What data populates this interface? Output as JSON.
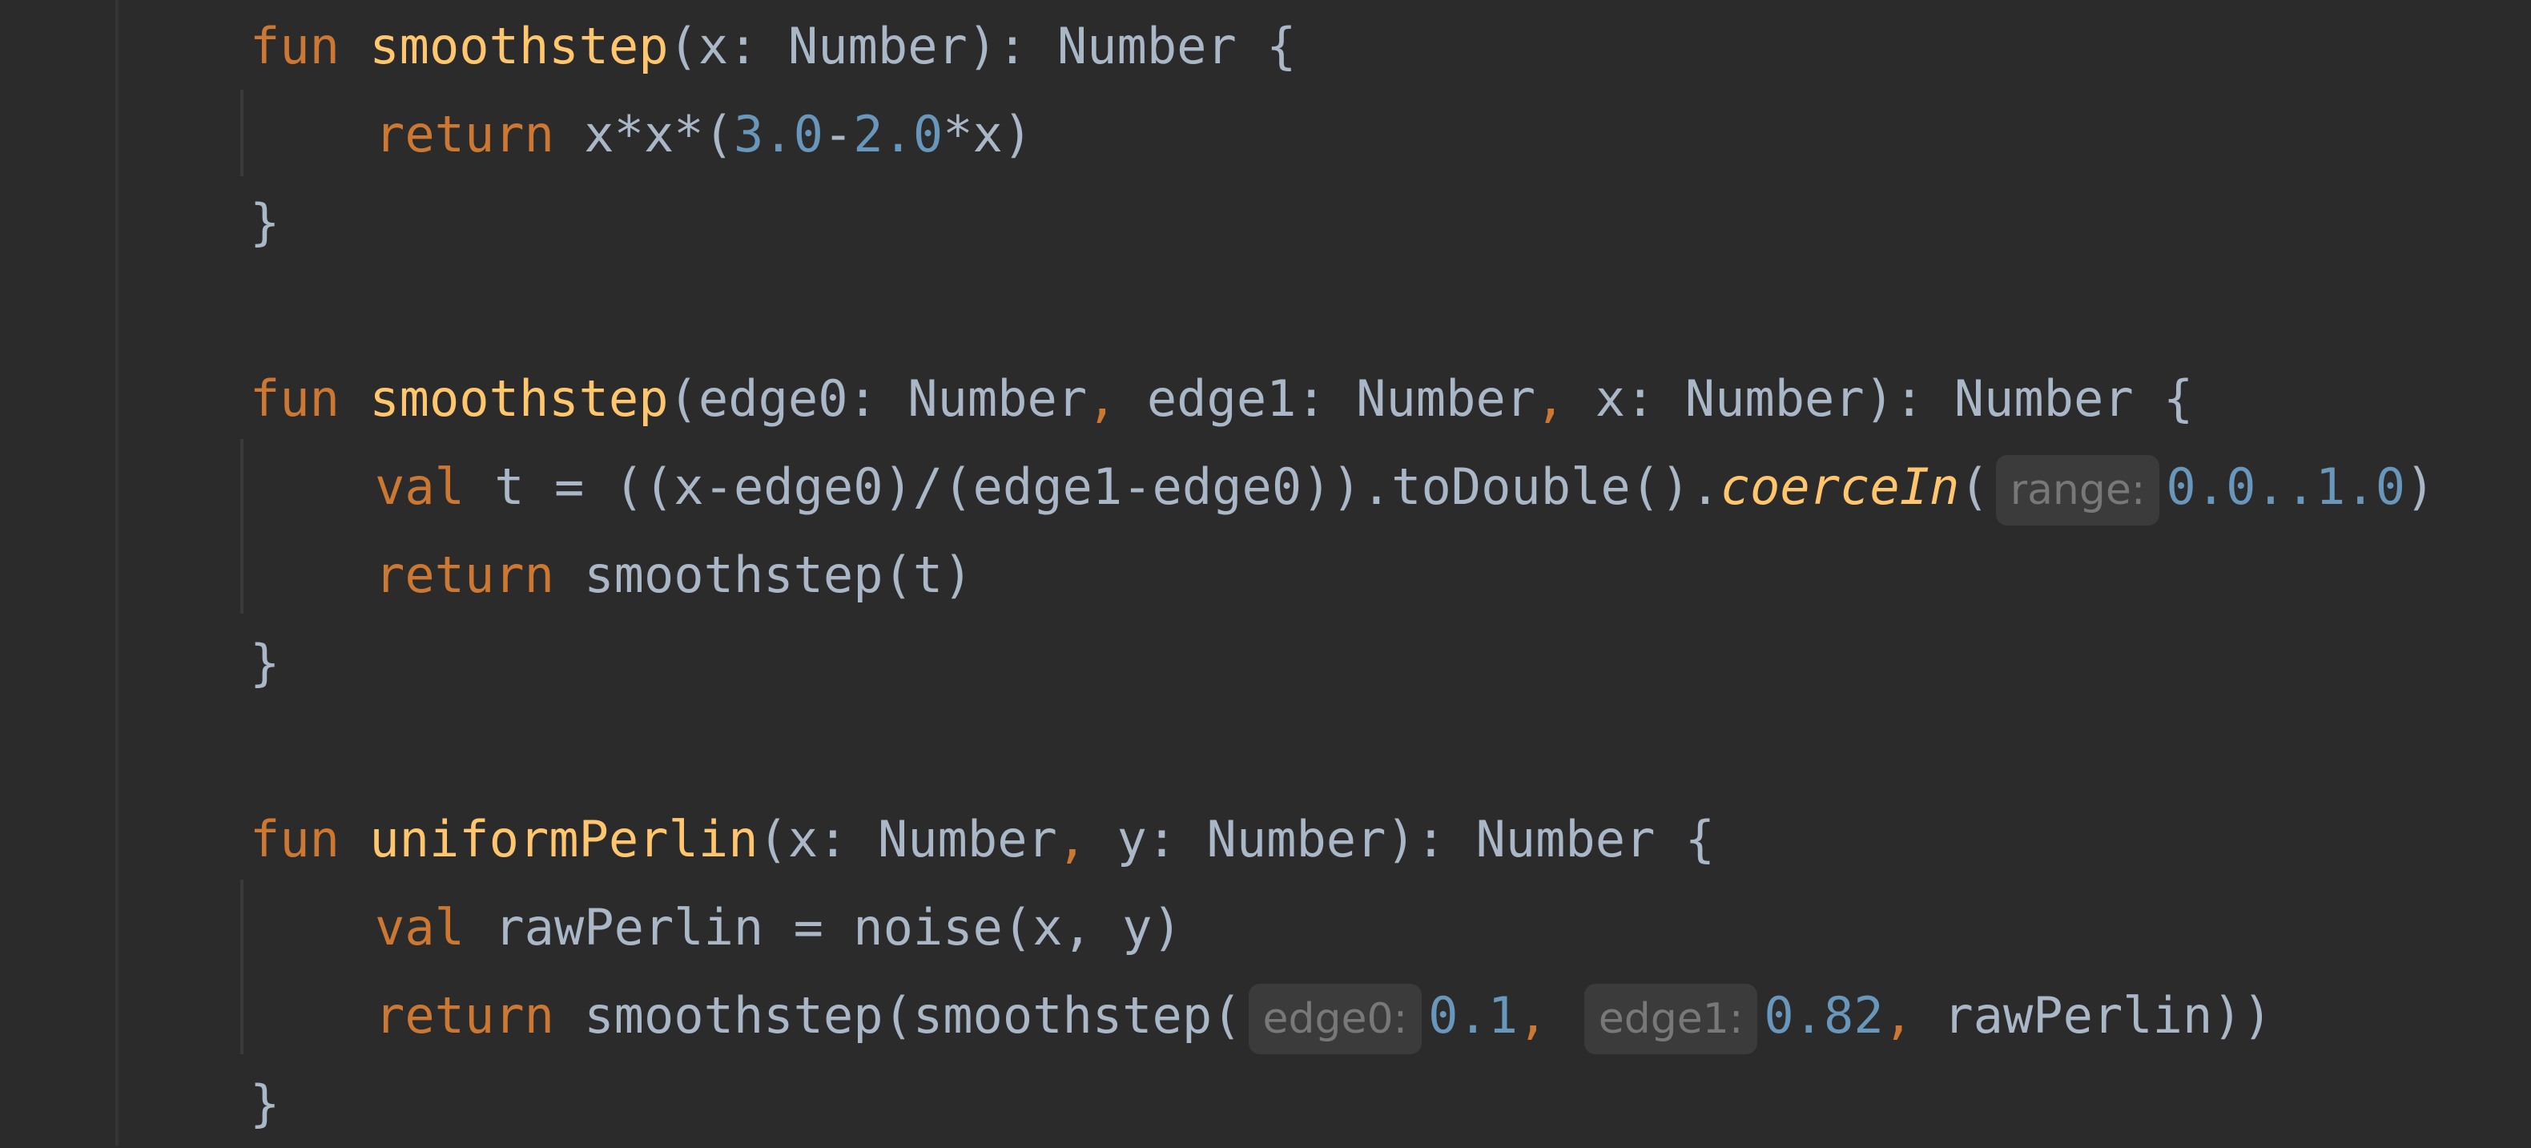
{
  "code": {
    "fn1": {
      "sig": {
        "kw": "fun",
        "name": "smoothstep",
        "params": "(x: Number): Number {"
      },
      "body": {
        "kw": "return",
        "a": "x*x*(",
        "n1": "3.0",
        "op": "-",
        "n2": "2.0",
        "b": "*x)"
      },
      "close": "}"
    },
    "fn2": {
      "sig": {
        "kw": "fun",
        "name": "smoothstep",
        "p1": "(edge0: Number",
        "c1": ",",
        "p2": " edge1: Number",
        "c2": ",",
        "p3": " x: Number): Number {"
      },
      "line1": {
        "kw": "val",
        "a": " t = ((x-edge0)/(edge1-edge0)).toDouble().",
        "call": "coerceIn",
        "open": "(",
        "hint": "range:",
        "range": "0.0..1.0",
        "close_paren": ")"
      },
      "line2": {
        "kw": "return",
        "a": " smoothstep(t)"
      },
      "close": "}"
    },
    "fn3": {
      "sig": {
        "kw": "fun",
        "name": "uniformPerlin",
        "p1": "(x: Number",
        "c1": ",",
        "p2": " y: Number): Number {"
      },
      "line1": {
        "kw": "val",
        "a": " rawPerlin = noise(x, y)"
      },
      "line2": {
        "kw": "return",
        "a": " smoothstep(smoothstep(",
        "hint1": "edge0:",
        "v1": "0.1",
        "c1": ",",
        "hint2": "edge1:",
        "v2": "0.82",
        "c2": ",",
        "rest": " rawPerlin))"
      },
      "close": "}"
    }
  }
}
